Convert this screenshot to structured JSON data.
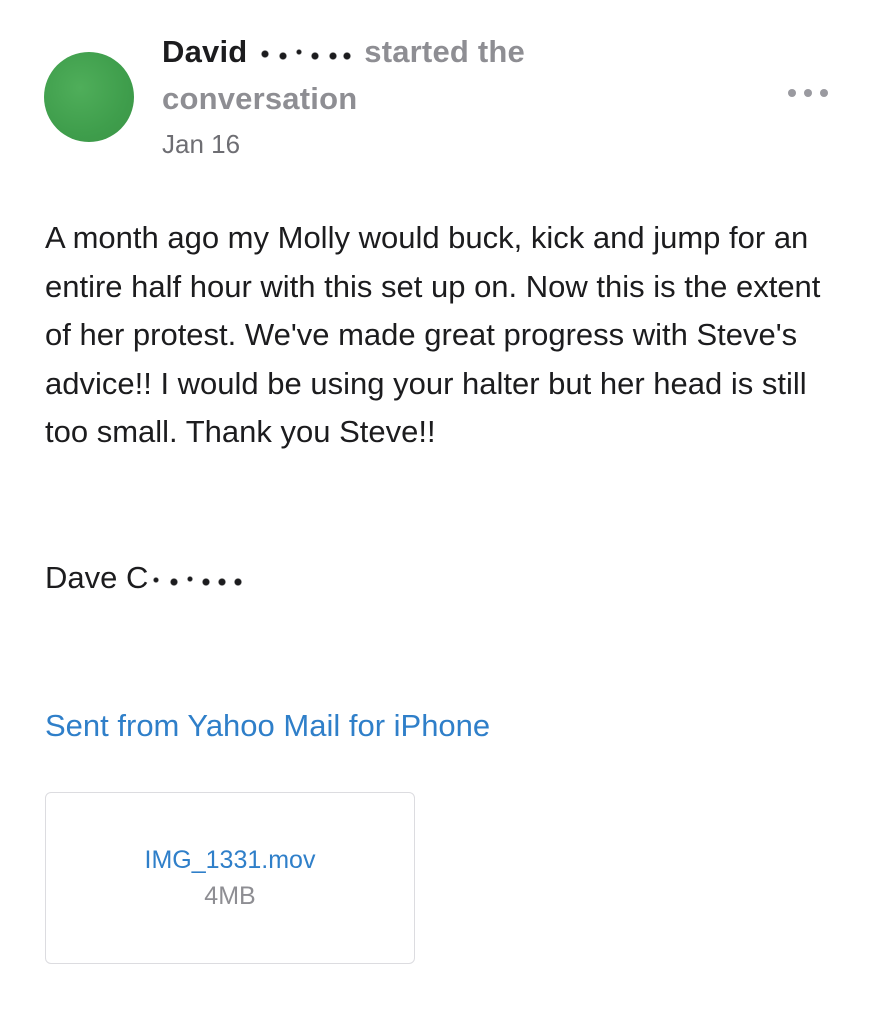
{
  "post": {
    "author_name": "David",
    "author_action": "started the conversation",
    "date": "Jan 16",
    "more_icon": "ellipsis-icon",
    "body": "A month ago my Molly would buck, kick and jump for an entire half hour with this set up on. Now this is the extent of her protest. We've made great progress with Steve's advice!! I would be using your halter but her head is still too small. Thank you Steve!!",
    "signature": "Dave C",
    "sent_from_link": "Sent from Yahoo Mail for iPhone",
    "attachment": {
      "filename": "IMG_1331.mov",
      "size": "4MB"
    }
  },
  "colors": {
    "avatar": "#3f9e4c",
    "link": "#2f7fc9",
    "muted": "#8e8e93",
    "text": "#1c1c1e"
  }
}
